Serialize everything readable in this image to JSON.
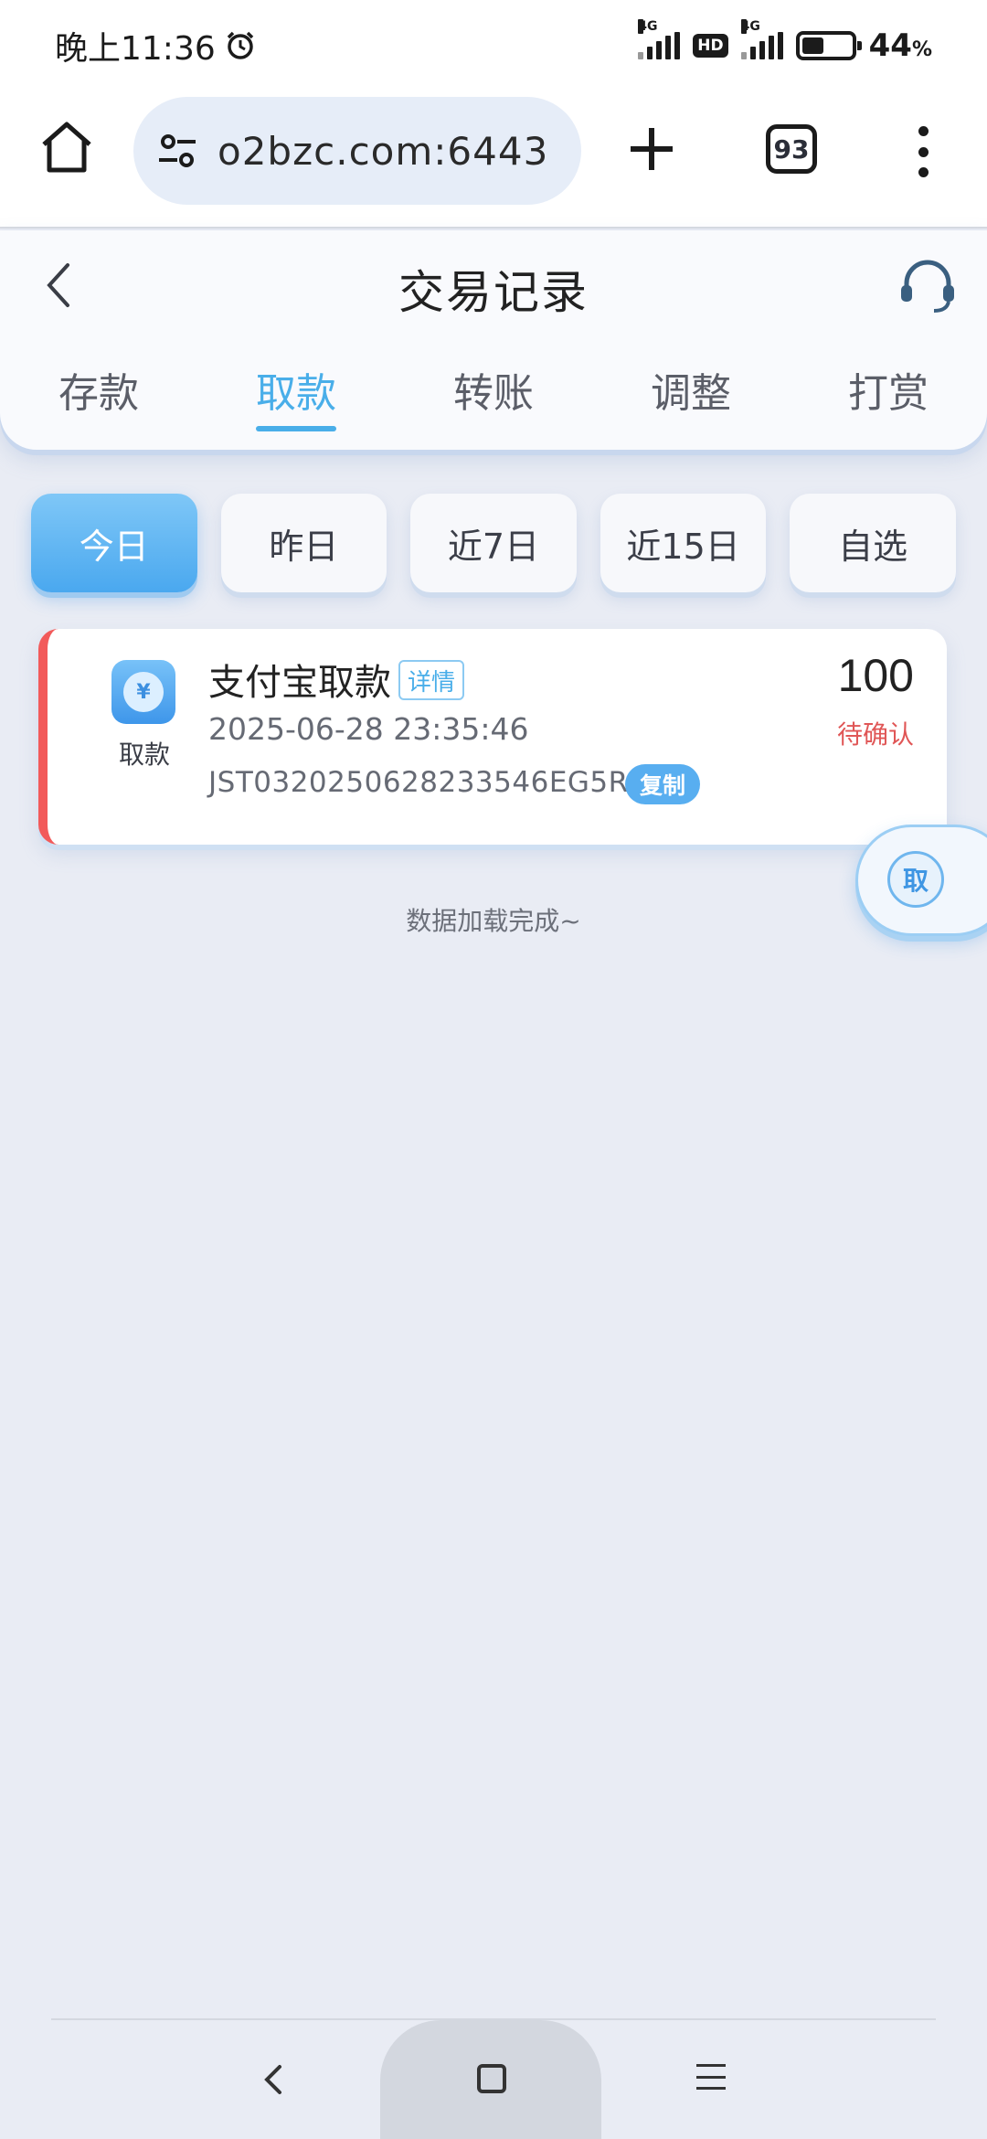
{
  "status_bar": {
    "time": "晚上11:36",
    "net1": "4G",
    "hd": "HD",
    "net2": "4G",
    "battery_percent": "44",
    "battery_unit": "%",
    "battery_level": 0.44
  },
  "browser": {
    "url": "o2bzc.com:6443",
    "tab_count": "93"
  },
  "header": {
    "title": "交易记录"
  },
  "tabs": [
    {
      "label": "存款",
      "active": false
    },
    {
      "label": "取款",
      "active": true
    },
    {
      "label": "转账",
      "active": false
    },
    {
      "label": "调整",
      "active": false
    },
    {
      "label": "打赏",
      "active": false
    }
  ],
  "filters": [
    {
      "label": "今日",
      "active": true
    },
    {
      "label": "昨日",
      "active": false
    },
    {
      "label": "近7日",
      "active": false
    },
    {
      "label": "近15日",
      "active": false
    },
    {
      "label": "自选",
      "active": false
    }
  ],
  "record": {
    "icon_glyph": "¥",
    "type": "取款",
    "title": "支付宝取款",
    "detail_label": "详情",
    "datetime": "2025-06-28 23:35:46",
    "order_no": "JST0320250628233546EG5R",
    "copy_label": "复制",
    "amount": "100",
    "status": "待确认"
  },
  "float_button": {
    "label": "取"
  },
  "load_complete_text": "数据加载完成~",
  "colors": {
    "accent": "#49aee9",
    "status_pending": "#e05656",
    "card_stripe": "#f25a5a",
    "background": "#e9ecf4"
  }
}
